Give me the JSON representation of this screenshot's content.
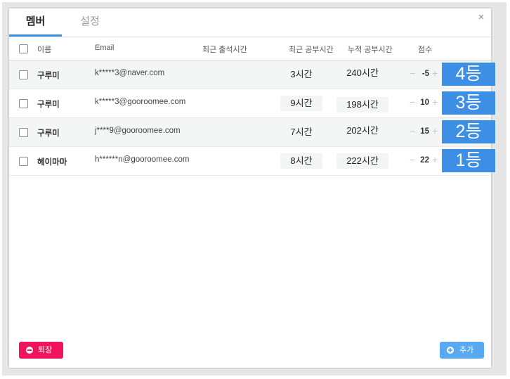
{
  "tabs": [
    {
      "label": "멤버",
      "active": true
    },
    {
      "label": "설정",
      "active": false
    }
  ],
  "close_icon": "×",
  "table": {
    "headers": {
      "name": "이름",
      "email": "Email",
      "last_attendance": "최근 출석시간",
      "last_study": "최근 공부시간",
      "total_study": "누적 공부시간",
      "score": "점수"
    },
    "rows": [
      {
        "name": "구루미",
        "email": "k*****3@naver.com",
        "last_study": "3시간",
        "total_study": "240시간",
        "score": "-5",
        "rank": "4등"
      },
      {
        "name": "구루미",
        "email": "k*****3@gooroomee.com",
        "last_study": "9시간",
        "total_study": "198시간",
        "score": "10",
        "rank": "3등"
      },
      {
        "name": "구루미",
        "email": "j****9@gooroomee.com",
        "last_study": "7시간",
        "total_study": "202시간",
        "score": "15",
        "rank": "2등"
      },
      {
        "name": "헤이마마",
        "email": "h******n@gooroomee.com",
        "last_study": "8시간",
        "total_study": "222시간",
        "score": "22",
        "rank": "1등"
      }
    ]
  },
  "footer": {
    "leave_label": "퇴장",
    "add_label": "추가"
  },
  "colors": {
    "accent": "#3b8ee8",
    "rank_badge": "#3d8ee5",
    "leave_button": "#f0135e",
    "add_button": "#58a9f2"
  },
  "icons": {
    "minus": "−",
    "plus": "+"
  }
}
